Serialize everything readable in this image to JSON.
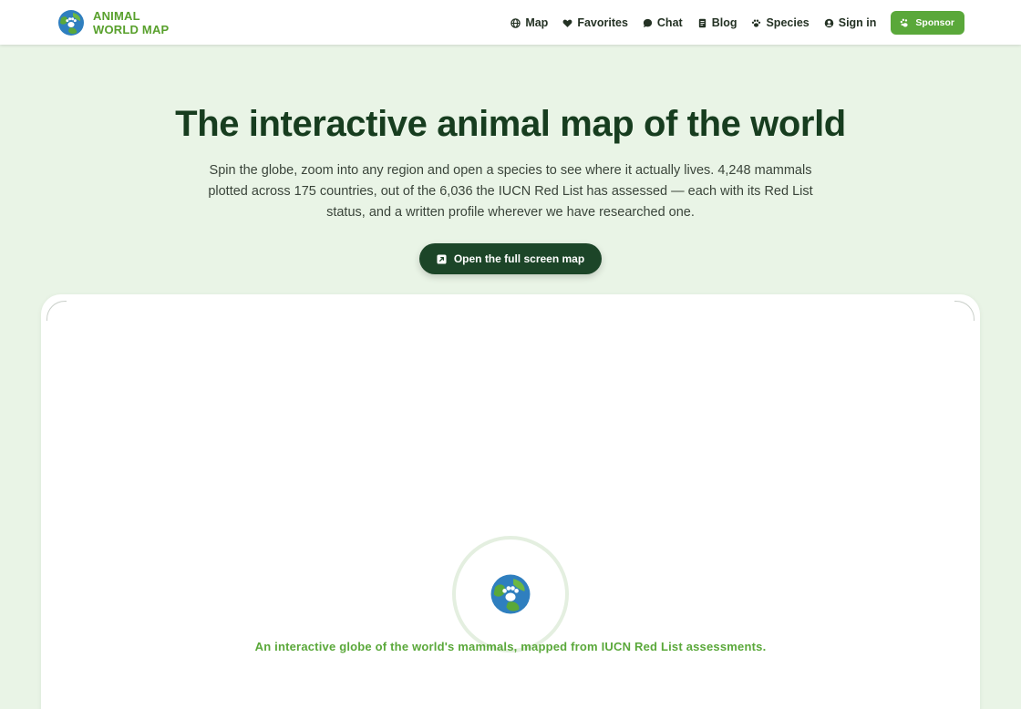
{
  "header": {
    "brand": {
      "line1": "ANIMAL",
      "line2": "WORLD MAP",
      "logo_icon": "globe-paw-icon"
    },
    "nav": [
      {
        "label": "Map",
        "icon": "globe-icon"
      },
      {
        "label": "Favorites",
        "icon": "heart-icon"
      },
      {
        "label": "Chat",
        "icon": "chat-bubble-icon"
      },
      {
        "label": "Blog",
        "icon": "document-icon"
      },
      {
        "label": "Species",
        "icon": "paw-icon"
      },
      {
        "label": "Sign in",
        "icon": "user-circle-icon"
      }
    ],
    "sponsor": {
      "label": "Sponsor",
      "icon": "paw-icon"
    }
  },
  "hero": {
    "title": "The interactive animal map of the world",
    "description": "Spin the globe, zoom into any region and open a species to see where it actually lives. 4,248 mammals plotted across 175 countries, out of the 6,036 the IUCN Red List has assessed — each with its Red List status, and a written profile wherever we have researched one.",
    "cta_label": "Open the full screen map",
    "cta_icon": "expand-icon"
  },
  "map": {
    "caption": "An interactive globe of the world's mammals, mapped from IUCN Red List assessments.",
    "loader_icon": "globe-paw-icon"
  },
  "colors": {
    "brand_green": "#58a02c",
    "dark_green": "#1c4528",
    "title_green": "#173d1f",
    "page_bg": "#e9f4e6"
  }
}
